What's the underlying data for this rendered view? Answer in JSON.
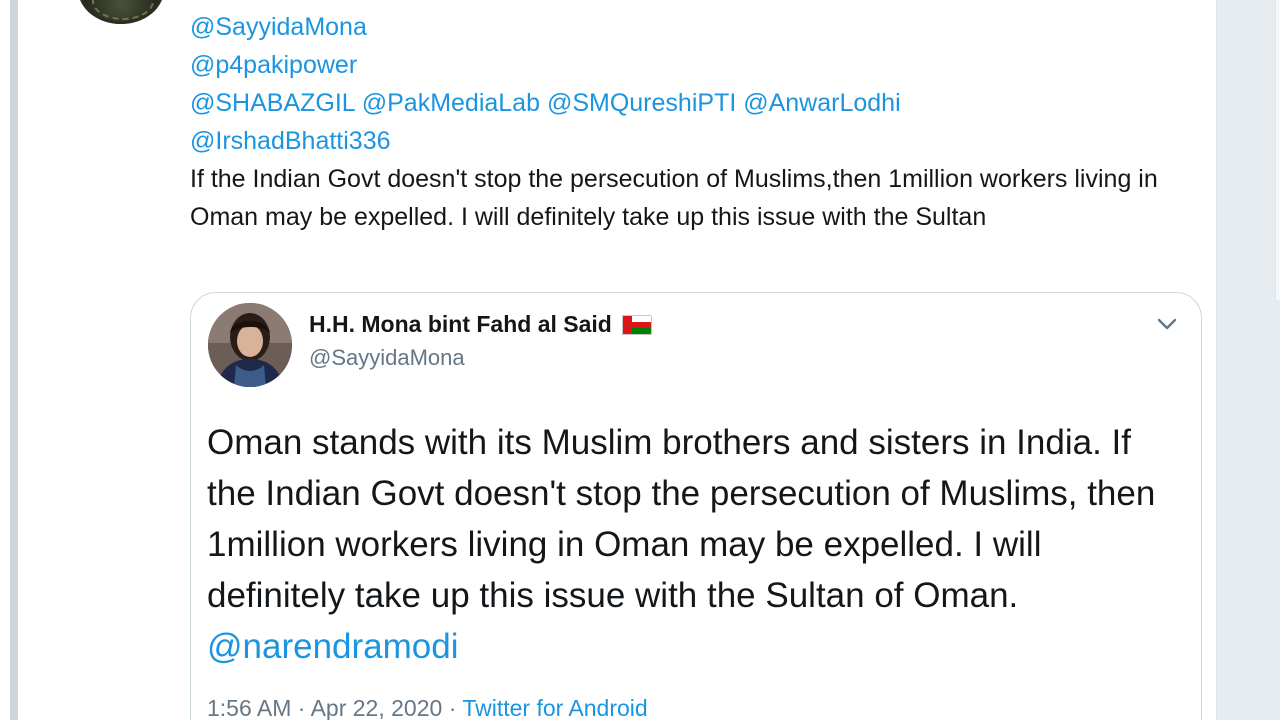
{
  "tweet": {
    "mentions_lines": [
      [
        "@SayyidaMona"
      ],
      [
        "@p4pakipower"
      ],
      [
        "@SHABAZGIL",
        "@PakMediaLab",
        "@SMQureshiPTI",
        "@AnwarLodhi"
      ],
      [
        "@IrshadBhatti336"
      ]
    ],
    "text": "If the Indian Govt doesn't stop the persecution of Muslims,then 1million workers living in Oman may be expelled. I will definitely take up this issue with the Sultan"
  },
  "quoted": {
    "name": "H.H. Mona bint Fahd al Said",
    "flag_icon": "oman-flag-icon",
    "handle": "@SayyidaMona",
    "text": "Oman stands with its Muslim brothers and sisters in India. If the Indian Govt doesn't stop the persecution of Muslims, then 1million workers living in Oman may be expelled. I will definitely take up this issue with the Sultan of Oman.",
    "mention": "@narendramodi",
    "time": "1:56 AM",
    "separator": "·",
    "date": "Apr 22, 2020",
    "source": "Twitter for Android"
  },
  "colors": {
    "link": "#1b95e0",
    "text": "#14171a",
    "muted": "#657786"
  }
}
